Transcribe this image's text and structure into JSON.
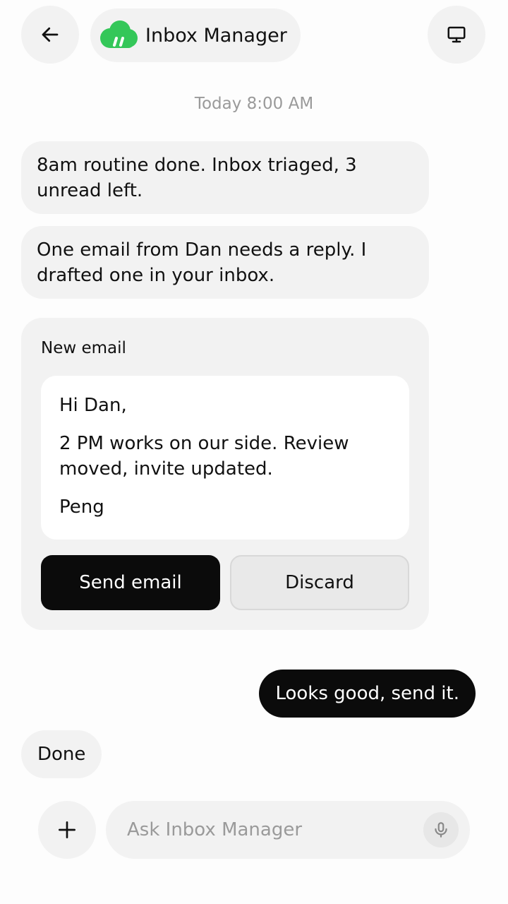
{
  "header": {
    "app_title": "Inbox Manager",
    "brand_color": "#34c759",
    "icons": {
      "back": "arrow-left-icon",
      "desktop": "monitor-icon"
    }
  },
  "conversation": {
    "timestamp": "Today 8:00 AM",
    "messages": [
      {
        "from": "assistant",
        "text": "8am routine done. Inbox triaged, 3 unread left."
      },
      {
        "from": "assistant",
        "text": "One email from Dan needs a reply. I drafted one in your inbox."
      }
    ],
    "email_card": {
      "title": "New email",
      "greeting": "Hi Dan,",
      "body": "2 PM works on our side. Review moved, invite updated.",
      "signature": "Peng",
      "send_label": "Send email",
      "discard_label": "Discard"
    },
    "user_reply": "Looks good, send it.",
    "assistant_done": "Done"
  },
  "composer": {
    "placeholder": "Ask Inbox Manager",
    "value": "",
    "icons": {
      "add": "plus-icon",
      "mic": "microphone-icon"
    }
  }
}
